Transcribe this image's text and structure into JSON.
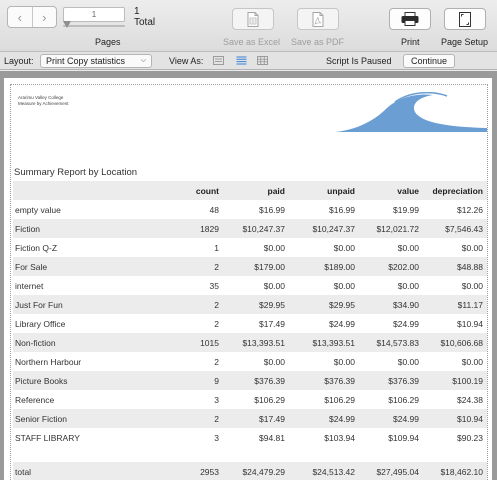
{
  "toolbar": {
    "page_input_value": "1",
    "page_total_number": "1",
    "page_total_label": "Total",
    "pages_label": "Pages",
    "save_excel_label": "Save as Excel",
    "save_pdf_label": "Save as PDF",
    "print_label": "Print",
    "page_setup_label": "Page Setup"
  },
  "layout_bar": {
    "layout_label": "Layout:",
    "layout_value": "Print Copy statistics",
    "view_as_label": "View As:",
    "script_status": "Script Is Paused",
    "continue_label": "Continue"
  },
  "report": {
    "institution_name": "Ararimu Valley College",
    "institution_tagline": "Measure by Achievement",
    "title": "Summary Report by Location",
    "columns": [
      "",
      "count",
      "paid",
      "unpaid",
      "value",
      "depreciation"
    ],
    "rows": [
      [
        "empty value",
        "48",
        "$16.99",
        "$16.99",
        "$19.99",
        "$12.26"
      ],
      [
        "Fiction",
        "1829",
        "$10,247.37",
        "$10,247.37",
        "$12,021.72",
        "$7,546.43"
      ],
      [
        "Fiction Q-Z",
        "1",
        "$0.00",
        "$0.00",
        "$0.00",
        "$0.00"
      ],
      [
        "For Sale",
        "2",
        "$179.00",
        "$189.00",
        "$202.00",
        "$48.88"
      ],
      [
        "internet",
        "35",
        "$0.00",
        "$0.00",
        "$0.00",
        "$0.00"
      ],
      [
        "Just For Fun",
        "2",
        "$29.95",
        "$29.95",
        "$34.90",
        "$11.17"
      ],
      [
        "Library Office",
        "2",
        "$17.49",
        "$24.99",
        "$24.99",
        "$10.94"
      ],
      [
        "Non-fiction",
        "1015",
        "$13,393.51",
        "$13,393.51",
        "$14,573.83",
        "$10,606.68"
      ],
      [
        "Northern Harbour",
        "2",
        "$0.00",
        "$0.00",
        "$0.00",
        "$0.00"
      ],
      [
        "Picture Books",
        "9",
        "$376.39",
        "$376.39",
        "$376.39",
        "$100.19"
      ],
      [
        "Reference",
        "3",
        "$106.29",
        "$106.29",
        "$106.29",
        "$24.38"
      ],
      [
        "Senior Fiction",
        "2",
        "$17.49",
        "$24.99",
        "$24.99",
        "$10.94"
      ],
      [
        "STAFF LIBRARY",
        "3",
        "$94.81",
        "$103.94",
        "$109.94",
        "$90.23"
      ]
    ],
    "total": [
      "total",
      "2953",
      "$24,479.29",
      "$24,513.42",
      "$27,495.04",
      "$18,462.10"
    ]
  },
  "icons": {
    "prev": "chevron-left-icon",
    "next": "chevron-right-icon",
    "excel": "excel-document-icon",
    "pdf": "pdf-document-icon",
    "print": "printer-icon",
    "page_setup": "page-setup-icon",
    "view_form": "form-view-icon",
    "view_list": "list-view-icon",
    "view_table": "table-view-icon"
  },
  "colors": {
    "logo_wave": "#6b9fd4",
    "row_shade": "#ececec",
    "doc_background": "#9a9a9a",
    "active_view": "#3b82d6"
  }
}
